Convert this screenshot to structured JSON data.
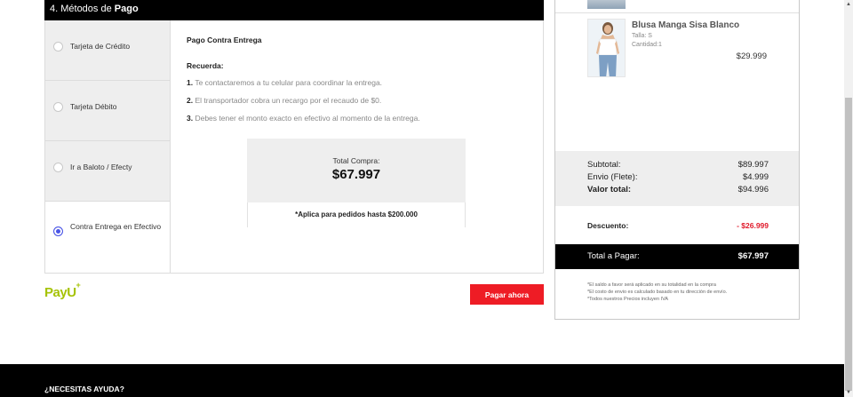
{
  "payment": {
    "header_prefix": "4. Métodos de",
    "header_strong": "Pago",
    "methods": [
      {
        "label": "Tarjeta de Crédito",
        "selected": false
      },
      {
        "label": "Tarjeta Débito",
        "selected": false
      },
      {
        "label": "Ir a Baloto / Efecty",
        "selected": false
      },
      {
        "label": "Contra Entrega en Efectivo",
        "selected": true
      }
    ],
    "detail_title": "Pago Contra Entrega",
    "recuerda": "Recuerda:",
    "steps": [
      {
        "num": "1.",
        "text": "Te contactaremos a tu celular para coordinar la entrega."
      },
      {
        "num": "2.",
        "text": "El transportador cobra un recargo por el recaudo de $0."
      },
      {
        "num": "3.",
        "text": "Debes tener el monto exacto en efectivo al momento de la entrega."
      }
    ],
    "total_label": "Total Compra:",
    "total_amount": "$67.997",
    "total_note": "*Aplica para pedidos hasta $200.000",
    "pay_button": "Pagar ahora",
    "logo_text": "PayU",
    "logo_mark": "+"
  },
  "summary": {
    "product": {
      "name": "Blusa Manga Sisa Blanco",
      "size": "Talla: S",
      "qty": "Cantidad:1",
      "price": "$29.999"
    },
    "totals": [
      {
        "label": "Subtotal:",
        "value": "$89.997"
      },
      {
        "label": "Envio (Flete):",
        "value": "$4.999"
      },
      {
        "label": "Valor total:",
        "value": "$94.996"
      }
    ],
    "discount_label": "Descuento:",
    "discount_value": "- $26.999",
    "topay_label": "Total a Pagar:",
    "topay_value": "$67.997",
    "fine_print": [
      "*El saldo a favor será aplicado en su totalidad en la compra",
      "*El costo de envio es calculado basado en tu dirección de envío.",
      "*Todos nuestros Precios incluyen IVA"
    ]
  },
  "footer": {
    "help": "¿NECESITAS AYUDA?"
  },
  "colors": {
    "accent_red": "#ee1c25",
    "discount_red": "#e0192a",
    "radio_selected": "#4a55e6",
    "payu_green": "#a6c307"
  }
}
